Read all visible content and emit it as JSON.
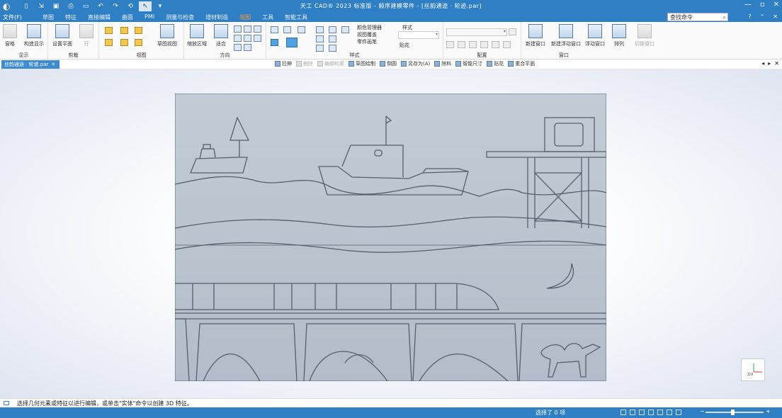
{
  "window": {
    "title": "天工 CAD® 2023 标准版 - 顺序建模零件 - [丝韵通途 · 轮迹.par]",
    "controls": [
      "—",
      "▫",
      "✕"
    ]
  },
  "menu": {
    "file": "文件(F)",
    "tabs": [
      "草图",
      "特征",
      "直接编辑",
      "曲面",
      "PMI",
      "测量与检查",
      "增材制造",
      "视图",
      "工具",
      "智能工具"
    ],
    "active_tab": "视图",
    "search_placeholder": "查找命令",
    "help": [
      "?",
      "⌃",
      "✕"
    ]
  },
  "ribbon": {
    "show": {
      "label": "显示",
      "pane": "窗格",
      "construct": "构造显示"
    },
    "clip": {
      "label": "剪裁",
      "set_plane": "设置平面",
      "on": "开"
    },
    "view": {
      "label": "视图",
      "sketch_view": "草图视图"
    },
    "orient": {
      "label": "方向",
      "zoom_area": "缩放区域",
      "fit": "适合"
    },
    "style": {
      "label": "样式",
      "color_mgr": "颜色管理器",
      "view_cover": "视图覆盖",
      "part_brush": "零件画笔",
      "style": "样式",
      "decal": "贴花"
    },
    "config": {
      "label": "配置"
    },
    "window": {
      "label": "窗口",
      "new_window": "新建窗口",
      "new_float": "新建浮动窗口",
      "float": "浮动窗口",
      "arrange": "排列",
      "switch": "切换窗口"
    }
  },
  "document": {
    "tab": "丝韵通途 · 轮迹.par",
    "commands": [
      {
        "label": "拉伸",
        "disabled": false
      },
      {
        "label": "删除",
        "disabled": true
      },
      {
        "label": "编辑轮廓",
        "disabled": true
      },
      {
        "label": "草图绘制",
        "disabled": false
      },
      {
        "label": "倒圆",
        "disabled": false
      },
      {
        "label": "另存为(A)",
        "disabled": false
      },
      {
        "label": "除料",
        "disabled": false
      },
      {
        "label": "智能尺寸",
        "disabled": false
      },
      {
        "label": "贴花",
        "disabled": false
      },
      {
        "label": "重合平面",
        "disabled": false
      }
    ],
    "nav": [
      "◂",
      "▸",
      "✕"
    ]
  },
  "viewport": {
    "triad_label": "Z​/X"
  },
  "prompt": "选择几何元素或特征以进行编辑，或单击\"实体\"命令以创建 3D 特征。",
  "status": {
    "message": "选择了 0 项",
    "zoom_minus": "−",
    "zoom_plus": "+"
  }
}
